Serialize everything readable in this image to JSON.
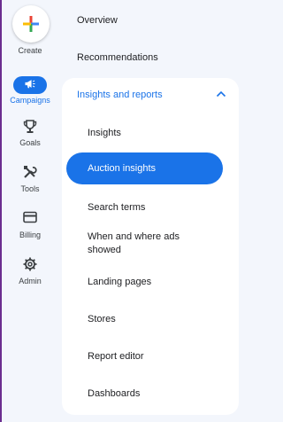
{
  "rail": {
    "create_label": "Create",
    "items": [
      {
        "label": "Campaigns",
        "icon": "megaphone-icon"
      },
      {
        "label": "Goals",
        "icon": "trophy-icon"
      },
      {
        "label": "Tools",
        "icon": "tools-icon"
      },
      {
        "label": "Billing",
        "icon": "credit-card-icon"
      },
      {
        "label": "Admin",
        "icon": "gear-icon"
      }
    ]
  },
  "nav": {
    "overview": "Overview",
    "recommendations": "Recommendations",
    "section_title": "Insights and reports",
    "items": [
      "Insights",
      "Auction insights",
      "Search terms",
      "When and where ads showed",
      "Landing pages",
      "Stores",
      "Report editor",
      "Dashboards"
    ]
  },
  "colors": {
    "accent": "#1a73e8",
    "background": "#f3f6fc",
    "panel": "#ffffff"
  }
}
